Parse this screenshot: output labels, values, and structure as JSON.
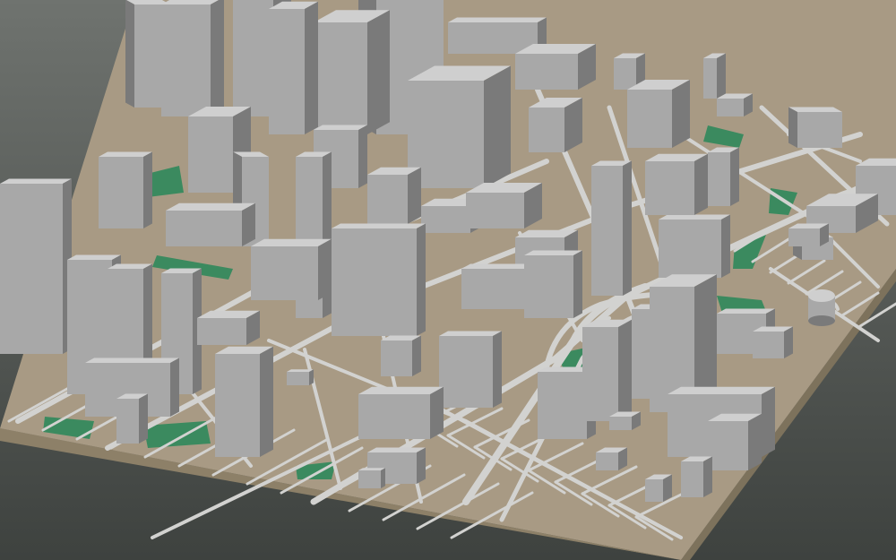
{
  "scene": {
    "type": "3d-city-block-model",
    "colors": {
      "background_top": "#6f736f",
      "background_bottom": "#3e423f",
      "ground": "#a89a84",
      "slab_side": "#8d8068",
      "road": "#d2d2d0",
      "park": "#3b8a5f",
      "roof": "#cfcfcf",
      "wall_light": "#a8a8a8",
      "wall_dark": "#7a7a7a"
    },
    "features": {
      "tower_count": 40,
      "park_count": 8,
      "has_curved_interchange": true,
      "has_cylindrical_building": true
    }
  }
}
